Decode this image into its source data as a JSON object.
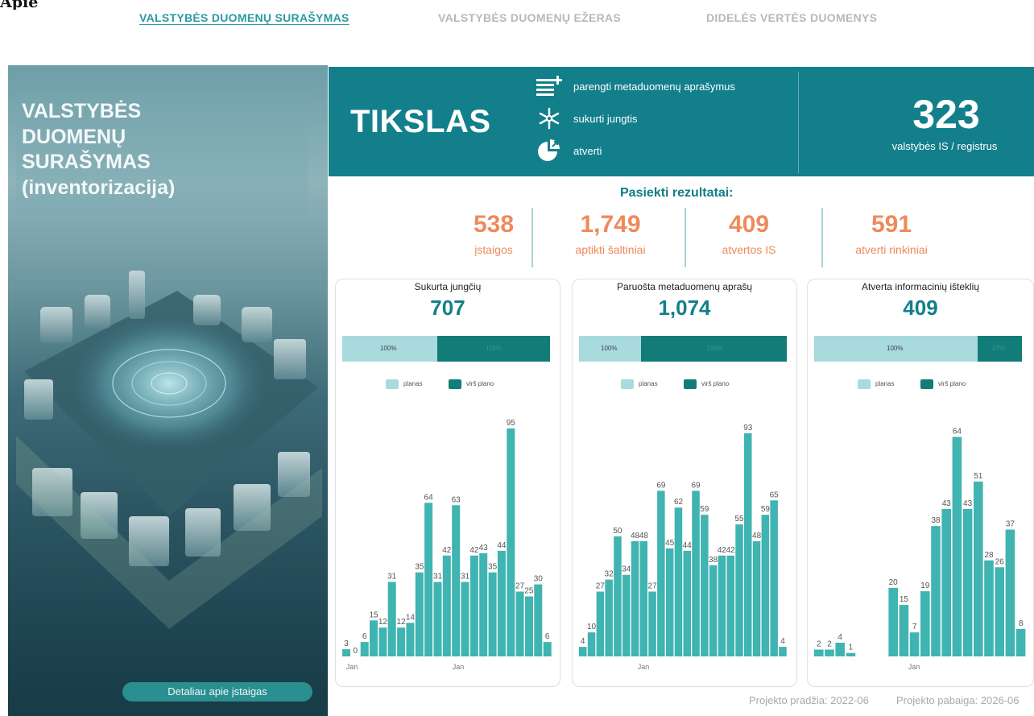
{
  "top_crop_text": "Apie",
  "nav": {
    "tabs": [
      {
        "label": "VALSTYBĖS DUOMENŲ SURAŠYMAS",
        "active": true
      },
      {
        "label": "VALSTYBĖS DUOMENŲ EŽERAS",
        "active": false
      },
      {
        "label": "DIDELĖS VERTĖS DUOMENYS",
        "active": false
      }
    ]
  },
  "hero": {
    "title": "VALSTYBĖS\nDUOMENŲ\nSURAŠYMAS\n(inventorizacija)",
    "button_label": "Detaliau apie įstaigas"
  },
  "goal": {
    "title": "TIKSLAS",
    "items": [
      {
        "icon": "list-add-icon",
        "label": "parengti metaduomenų aprašymus"
      },
      {
        "icon": "asterisk-connect-icon",
        "label": "sukurti jungtis"
      },
      {
        "icon": "pie-open-icon",
        "label": "atverti"
      }
    ],
    "total_number": "323",
    "total_label": "valstybės IS / registrus"
  },
  "results": {
    "title": "Pasiekti rezultatai:",
    "kpis": [
      {
        "value": "538",
        "label": "įstaigos"
      },
      {
        "value": "1,749",
        "label": "aptikti šaltiniai"
      },
      {
        "value": "409",
        "label": "atvertos IS"
      },
      {
        "value": "591",
        "label": "atverti rinkiniai"
      }
    ]
  },
  "colors": {
    "accent": "#137f8b",
    "plan": "#a8dade",
    "over": "#127c78",
    "kpi": "#ee8a5c",
    "bar": "#3fb4b1"
  },
  "legend": {
    "plan": "planas",
    "over": "virš plano"
  },
  "footer": {
    "start": "Projekto pradžia: 2022-06",
    "end": "Projekto pabaiga: 2026-06"
  },
  "chart_data": [
    {
      "type": "bar",
      "title": "Sukurta jungčių",
      "total": "707",
      "progress": {
        "plan_label": "100%",
        "over_label": "119%",
        "plan_fraction": 0.457
      },
      "x_tick_labels": [
        "Jan",
        "Jan"
      ],
      "values": [
        3,
        0,
        6,
        15,
        12,
        31,
        12,
        14,
        35,
        64,
        31,
        42,
        63,
        31,
        42,
        43,
        35,
        44,
        95,
        27,
        25,
        30,
        6
      ]
    },
    {
      "type": "bar",
      "title": "Paruošta metaduomenų aprašų",
      "total": "1,074",
      "progress": {
        "plan_label": "100%",
        "over_label": "233%",
        "plan_fraction": 0.3
      },
      "x_tick_labels": [
        "Jan"
      ],
      "values": [
        4,
        10,
        27,
        32,
        50,
        34,
        48,
        48,
        27,
        69,
        45,
        62,
        44,
        69,
        59,
        38,
        42,
        42,
        55,
        93,
        48,
        59,
        65,
        4
      ]
    },
    {
      "type": "bar",
      "title": "Atverta informacinių išteklių",
      "total": "409",
      "progress": {
        "plan_label": "100%",
        "over_label": "27%",
        "plan_fraction": 0.787
      },
      "x_tick_labels": [
        "Jan"
      ],
      "values": [
        2,
        2,
        4,
        1,
        null,
        null,
        null,
        20,
        15,
        7,
        19,
        38,
        43,
        64,
        43,
        51,
        28,
        26,
        37,
        8
      ]
    }
  ]
}
